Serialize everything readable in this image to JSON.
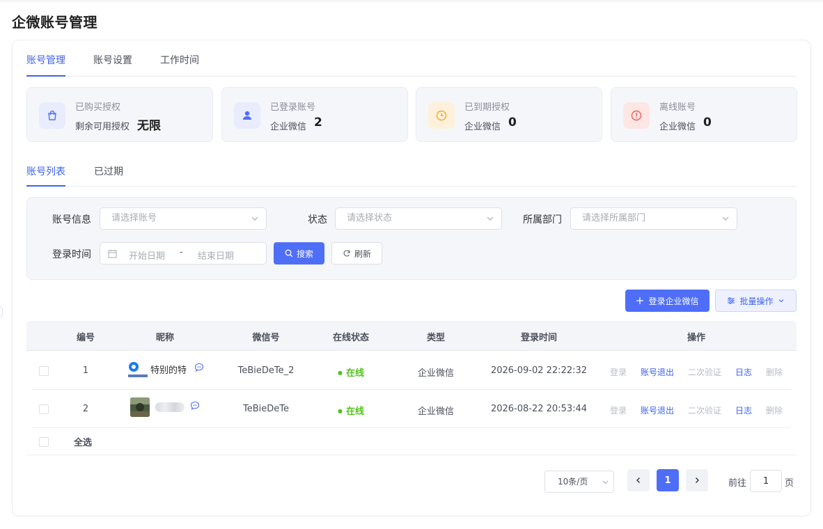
{
  "page": {
    "title": "企微账号管理"
  },
  "tabs": [
    {
      "label": "账号管理",
      "active": true
    },
    {
      "label": "账号设置",
      "active": false
    },
    {
      "label": "工作时间",
      "active": false
    }
  ],
  "stats": [
    {
      "title": "已购买授权",
      "label": "剩余可用授权",
      "value": "无限",
      "icon": "shopping-bag-icon",
      "color": "#4f6ef7"
    },
    {
      "title": "已登录账号",
      "label": "企业微信",
      "value": "2",
      "icon": "user-icon",
      "color": "#4f6ef7"
    },
    {
      "title": "已到期授权",
      "label": "企业微信",
      "value": "0",
      "icon": "clock-icon",
      "color": "#f5a623"
    },
    {
      "title": "离线账号",
      "label": "企业微信",
      "value": "0",
      "icon": "alert-circle-icon",
      "color": "#f25c54"
    }
  ],
  "subtabs": [
    {
      "label": "账号列表",
      "active": true
    },
    {
      "label": "已过期",
      "active": false
    }
  ],
  "filters": {
    "account_label": "账号信息",
    "account_placeholder": "请选择账号",
    "status_label": "状态",
    "status_placeholder": "请选择状态",
    "dept_label": "所属部门",
    "dept_placeholder": "请选择所属部门",
    "time_label": "登录时间",
    "start_placeholder": "开始日期",
    "end_placeholder": "结束日期",
    "separator": "-",
    "search_label": "搜索",
    "refresh_label": "刷新"
  },
  "actions": {
    "login_label": "登录企业微信",
    "batch_label": "批量操作"
  },
  "table": {
    "headers": [
      "编号",
      "昵称",
      "微信号",
      "在线状态",
      "类型",
      "登录时间",
      "操作"
    ],
    "rows": [
      {
        "id": "1",
        "nickname": "特别的特",
        "wechat": "TeBieDeTe_2",
        "status": "在线",
        "type": "企业微信",
        "time": "2026-09-02 22:22:32"
      },
      {
        "id": "2",
        "nickname": "",
        "wechat": "TeBieDeTe",
        "status": "在线",
        "type": "企业微信",
        "time": "2026-08-22 20:53:44"
      }
    ],
    "ops": [
      "登录",
      "账号退出",
      "二次验证",
      "日志",
      "删除"
    ],
    "select_all": "全选"
  },
  "pagination": {
    "page_size": "10条/页",
    "current": "1",
    "goto_prefix": "前往",
    "goto_value": "1",
    "goto_suffix": "页"
  },
  "colors": {
    "primary": "#4f6ef7",
    "online": "#52c41a"
  }
}
